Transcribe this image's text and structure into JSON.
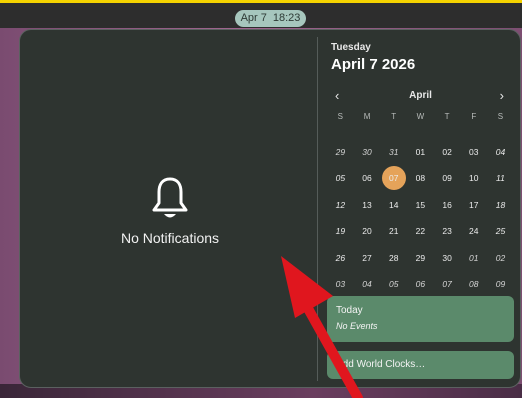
{
  "topbar": {
    "clock_date": "Apr 7",
    "clock_time": "18:23"
  },
  "notifications": {
    "empty_text": "No Notifications",
    "icon": "bell-icon"
  },
  "calendar": {
    "weekday": "Tuesday",
    "date": "April 7 2026",
    "month": "April",
    "prev_symbol": "‹",
    "next_symbol": "›",
    "day_headers": [
      "S",
      "M",
      "T",
      "W",
      "T",
      "F",
      "S"
    ],
    "weeks": [
      [
        "29",
        "30",
        "31",
        "01",
        "02",
        "03",
        "04"
      ],
      [
        "05",
        "06",
        "07",
        "08",
        "09",
        "10",
        "11"
      ],
      [
        "12",
        "13",
        "14",
        "15",
        "16",
        "17",
        "18"
      ],
      [
        "19",
        "20",
        "21",
        "22",
        "23",
        "24",
        "25"
      ],
      [
        "26",
        "27",
        "28",
        "29",
        "30",
        "01",
        "02"
      ],
      [
        "03",
        "04",
        "05",
        "06",
        "07",
        "08",
        "09"
      ]
    ],
    "selected_day": "07"
  },
  "events": {
    "title": "Today",
    "subtitle": "No Events"
  },
  "world_clocks": {
    "label": "Add World Clocks…"
  },
  "colors": {
    "accent": "#e5a35a",
    "card": "#5b8a6b",
    "popover": "#2e3430",
    "annotation_arrow": "#e0161e",
    "topbar_highlight": "#f5d300"
  }
}
